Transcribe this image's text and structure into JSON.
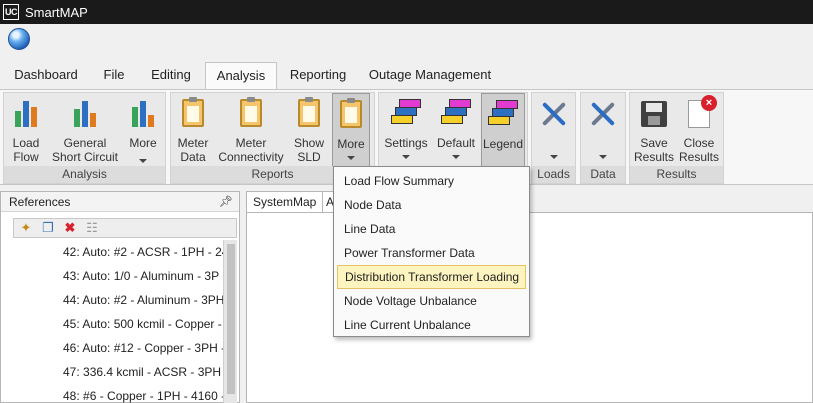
{
  "app": {
    "logo_text": "UC",
    "title": "SmartMAP"
  },
  "tabs": [
    {
      "label": "Dashboard",
      "active": false
    },
    {
      "label": "File",
      "active": false
    },
    {
      "label": "Editing",
      "active": false
    },
    {
      "label": "Analysis",
      "active": true
    },
    {
      "label": "Reporting",
      "active": false
    },
    {
      "label": "Outage Management",
      "active": false
    }
  ],
  "ribbon": {
    "analysis": {
      "label": "Analysis",
      "load_flow": "Load\nFlow",
      "short_circuit": "General\nShort Circuit",
      "more": "More"
    },
    "reports": {
      "label": "Reports",
      "meter_data": "Meter\nData",
      "meter_connectivity": "Meter\nConnectivity",
      "show_sld": "Show\nSLD",
      "more": "More"
    },
    "settings": {
      "settings": "Settings",
      "default": "Default",
      "legend": "Legend"
    },
    "loads": {
      "label": "Loads"
    },
    "data": {
      "label": "Data"
    },
    "results": {
      "label": "Results",
      "save": "Save\nResults",
      "close": "Close\nResults"
    }
  },
  "references": {
    "title": "References",
    "pin_icon": "pin-icon",
    "items": [
      "42: Auto: #2 - ACSR - 1PH - 24",
      "43: Auto: 1/0 - Aluminum - 3P",
      "44: Auto: #2 - Aluminum - 3PH",
      "45: Auto: 500 kcmil - Copper -",
      "46: Auto: #12 - Copper - 3PH -",
      "47: 336.4 kcmil - ACSR - 3PH -",
      "48: #6 - Copper - 1PH - 4160 -"
    ]
  },
  "document_tabs": [
    "SystemMap",
    "A"
  ],
  "more_menu": {
    "items": [
      "Load Flow Summary",
      "Node Data",
      "Line Data",
      "Power Transformer Data",
      "Distribution Transformer Loading",
      "Node Voltage Unbalance",
      "Line Current Unbalance"
    ],
    "highlighted_index": 4
  },
  "colors": {
    "titlebar": "#1a1a1a",
    "bar_green": "#3aa35a",
    "bar_blue": "#2d6fc0",
    "bar_orange": "#e07a1f",
    "layer_magenta": "#e23bd2",
    "layer_blue": "#2d6fc0",
    "layer_yellow": "#f5d02b",
    "close_red": "#d8202c",
    "menu_highlight": "#fdf4bf"
  }
}
